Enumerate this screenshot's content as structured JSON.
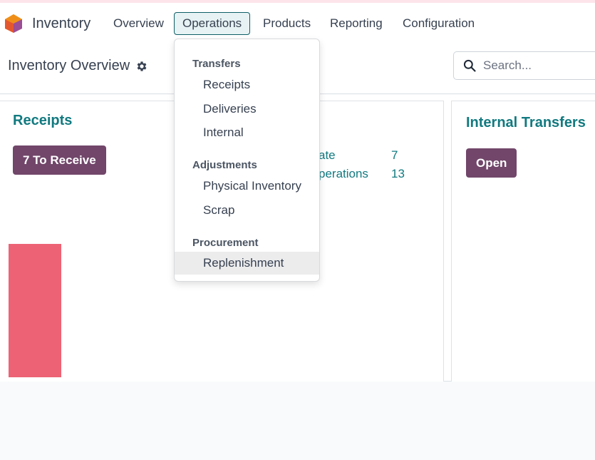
{
  "app": {
    "name": "Inventory",
    "logo_icon": "odoo-inventory-logo-icon"
  },
  "nav": {
    "items": [
      {
        "label": "Overview"
      },
      {
        "label": "Operations",
        "active": true
      },
      {
        "label": "Products"
      },
      {
        "label": "Reporting"
      },
      {
        "label": "Configuration"
      }
    ]
  },
  "control": {
    "title": "Inventory Overview",
    "search_placeholder": "Search..."
  },
  "cards": {
    "receipts": {
      "title": "Receipts",
      "button": "7 To Receive",
      "stats": [
        {
          "label": "ate",
          "value": "7"
        },
        {
          "label": "perations",
          "value": "13"
        }
      ]
    },
    "internal": {
      "title": "Internal Transfers",
      "button": "Open"
    }
  },
  "dropdown": {
    "sections": [
      {
        "header": "Transfers",
        "items": [
          "Receipts",
          "Deliveries",
          "Internal"
        ]
      },
      {
        "header": "Adjustments",
        "items": [
          "Physical Inventory",
          "Scrap"
        ]
      },
      {
        "header": "Procurement",
        "items": [
          "Replenishment"
        ]
      }
    ],
    "hovered_item": "Replenishment"
  },
  "colors": {
    "accent_teal": "#117a80",
    "primary_button": "#71466a",
    "active_nav_bg": "#e6f2f3",
    "graph_bar": "#ed6375"
  }
}
